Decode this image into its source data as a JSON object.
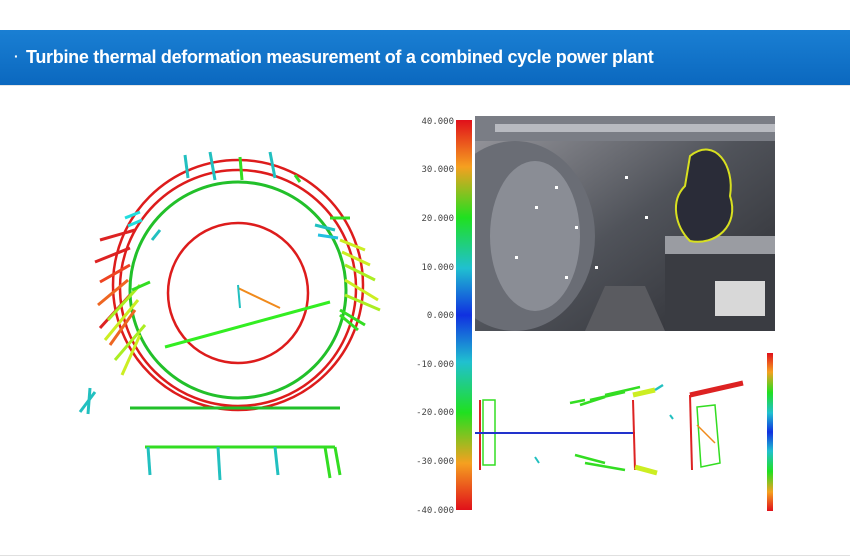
{
  "header": {
    "bullet": "·",
    "title": "Turbine thermal deformation measurement of a combined cycle power plant"
  },
  "colorbar": {
    "labels": [
      "40.000",
      "30.000",
      "20.000",
      "10.000",
      "0.000",
      "-10.000",
      "-20.000",
      "-30.000",
      "-40.000"
    ]
  },
  "colors": {
    "header": "#0b6fc8",
    "ring": "#dd1c1c",
    "measurement": "#22dd22"
  }
}
